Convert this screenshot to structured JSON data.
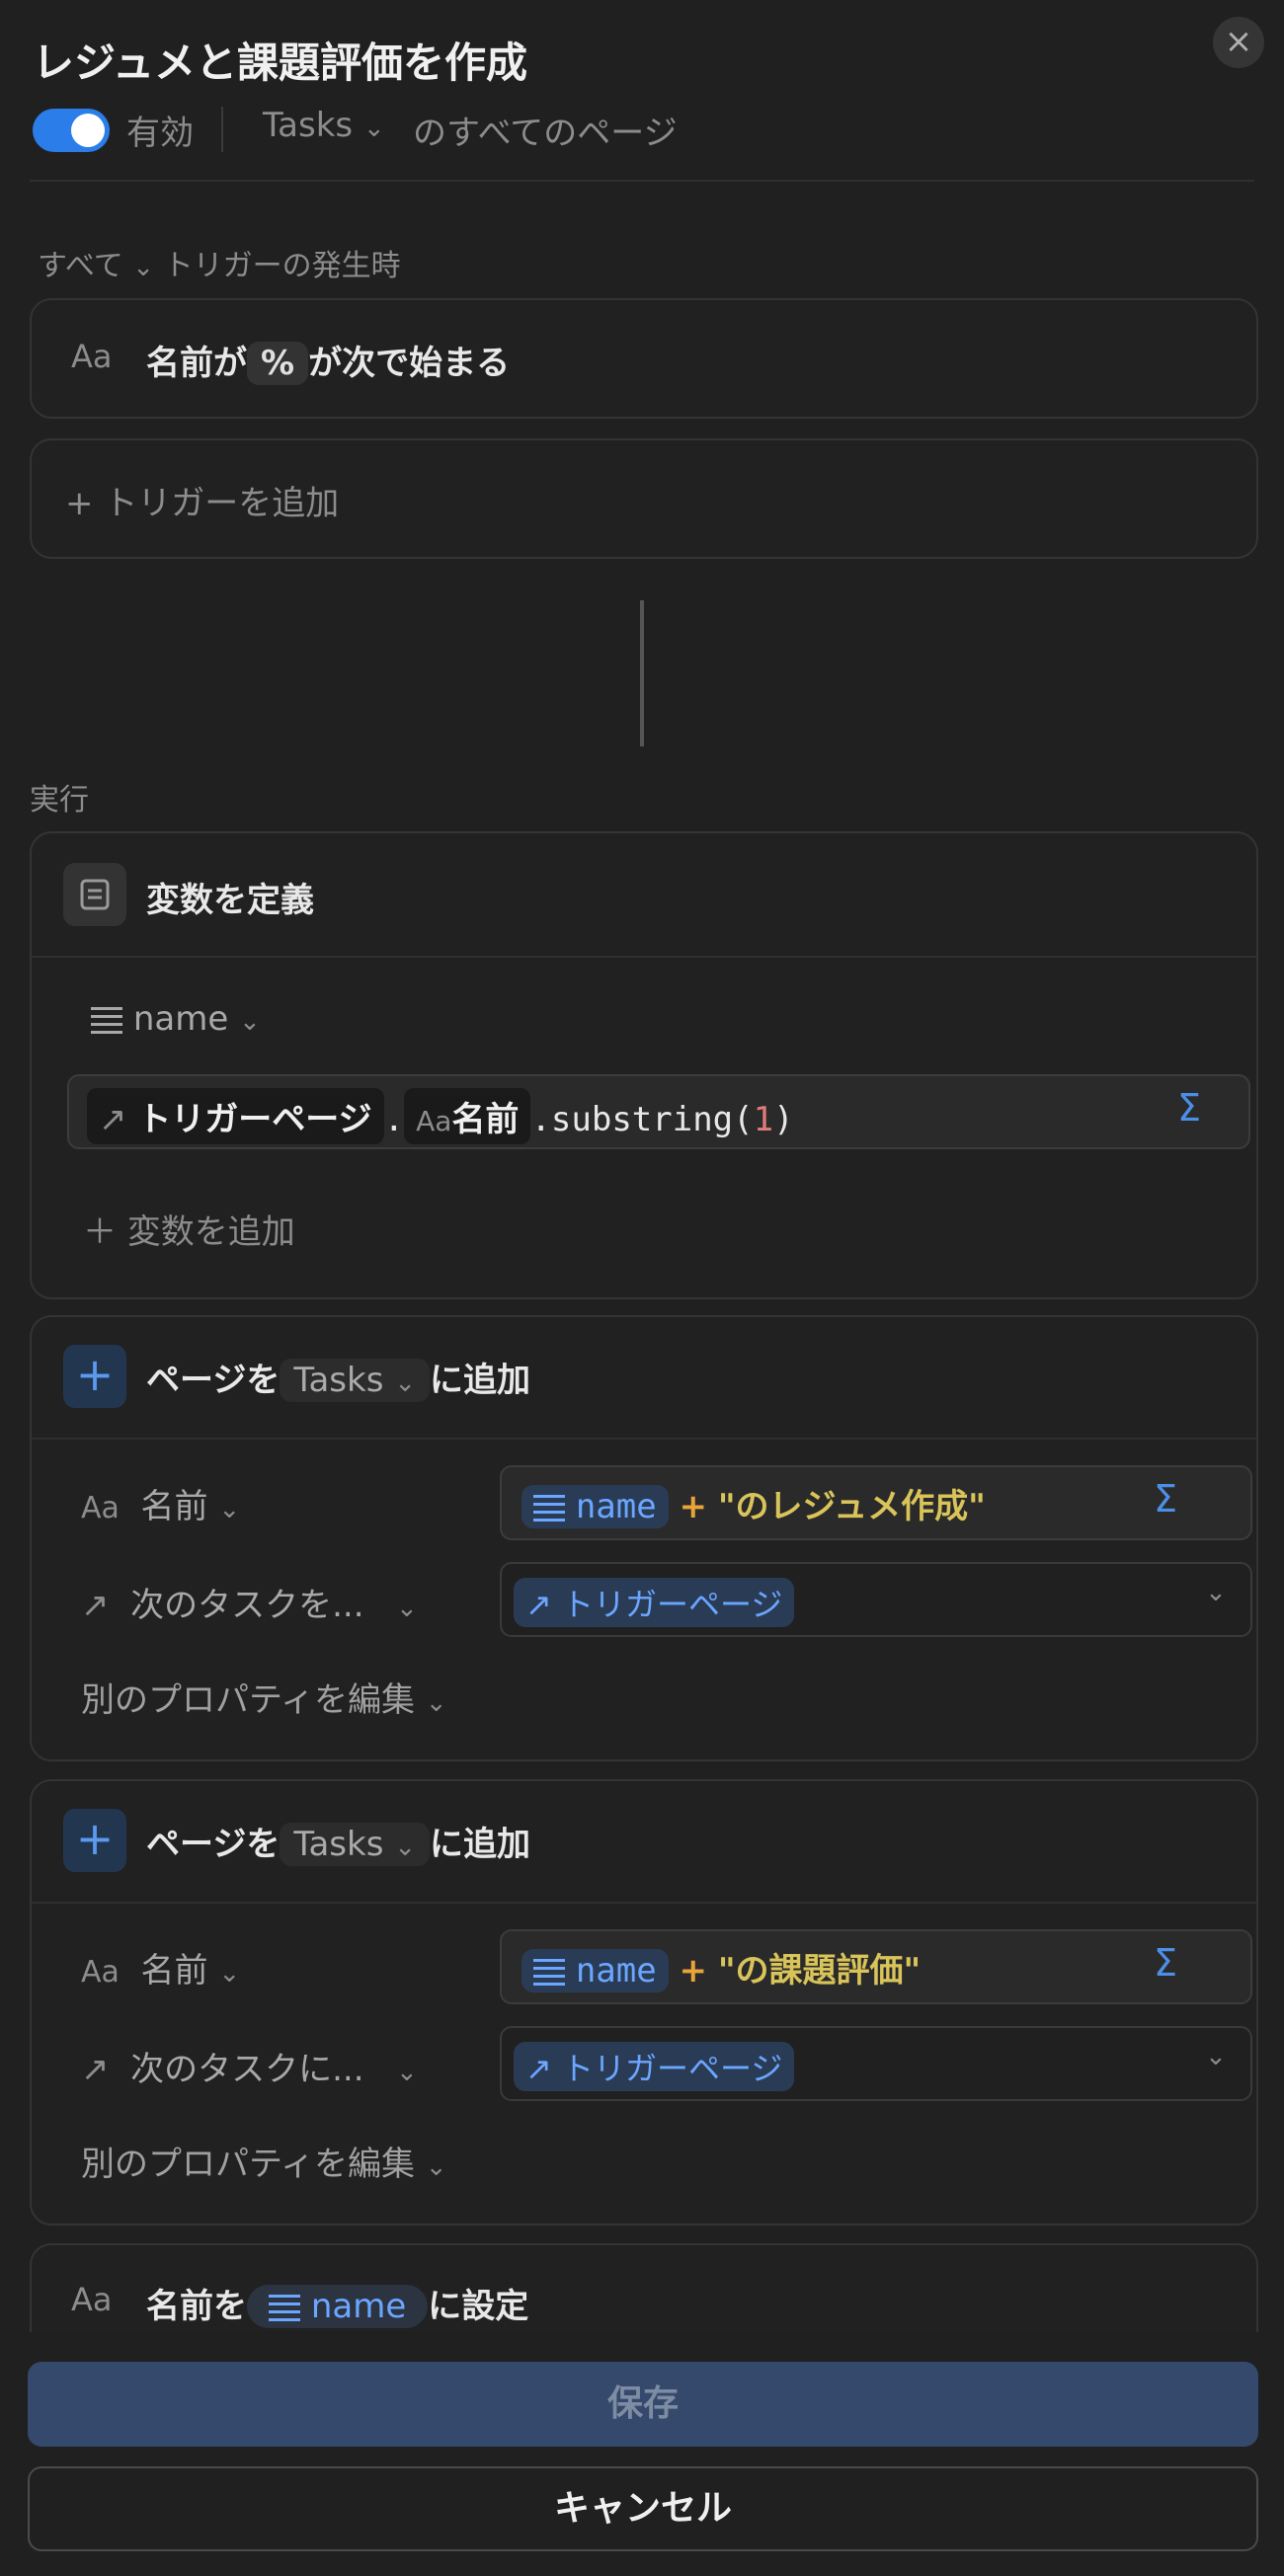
{
  "header": {
    "title": "レジュメと課題評価を作成",
    "close_glyph": "×",
    "toggle_label": "有効",
    "db_name": "Tasks",
    "scope_text": "のすべてのページ"
  },
  "trigger_section": {
    "label_all": "すべて",
    "label_when": "トリガーの発生時",
    "condition_icon": "Aa",
    "condition_prefix": "名前が",
    "condition_value": "%",
    "condition_suffix": "が次で始まる",
    "add_trigger_label": "トリガーを追加"
  },
  "actions_label": "実行",
  "define_vars": {
    "title": "変数を定義",
    "var_name": "name",
    "formula_chip1": "トリガーページ",
    "formula_dot1": ".",
    "formula_chip2_icon": "Aa",
    "formula_chip2": "名前",
    "formula_rest": ".substring(",
    "formula_arg": "1",
    "formula_close": ")",
    "sigma": "Σ",
    "add_var_label": "変数を追加"
  },
  "add_page_1": {
    "prefix": "ページを",
    "db": "Tasks",
    "suffix": "に追加",
    "prop1_icon": "Aa",
    "prop1_label": "名前",
    "prop1_var": "name",
    "prop1_plus": "+",
    "prop1_string": "\"のレジュメ作成\"",
    "prop2_label": "次のタスクを...",
    "prop2_value": "トリガーページ",
    "edit_other": "別のプロパティを編集"
  },
  "add_page_2": {
    "prefix": "ページを",
    "db": "Tasks",
    "suffix": "に追加",
    "prop1_icon": "Aa",
    "prop1_label": "名前",
    "prop1_var": "name",
    "prop1_plus": "+",
    "prop1_string": "\"の課題評価\"",
    "prop2_label": "次のタスクに...",
    "prop2_value": "トリガーページ",
    "edit_other": "別のプロパティを編集"
  },
  "set_action": {
    "icon": "Aa",
    "prefix": "名前を",
    "var": "name",
    "suffix": "に設定"
  },
  "footer": {
    "save_label": "保存",
    "cancel_label": "キャンセル"
  },
  "colors": {
    "accent": "#2b7de9",
    "formula_string": "#d9c45a",
    "formula_plus": "#e8a33b",
    "formula_number": "#e07b7b"
  }
}
